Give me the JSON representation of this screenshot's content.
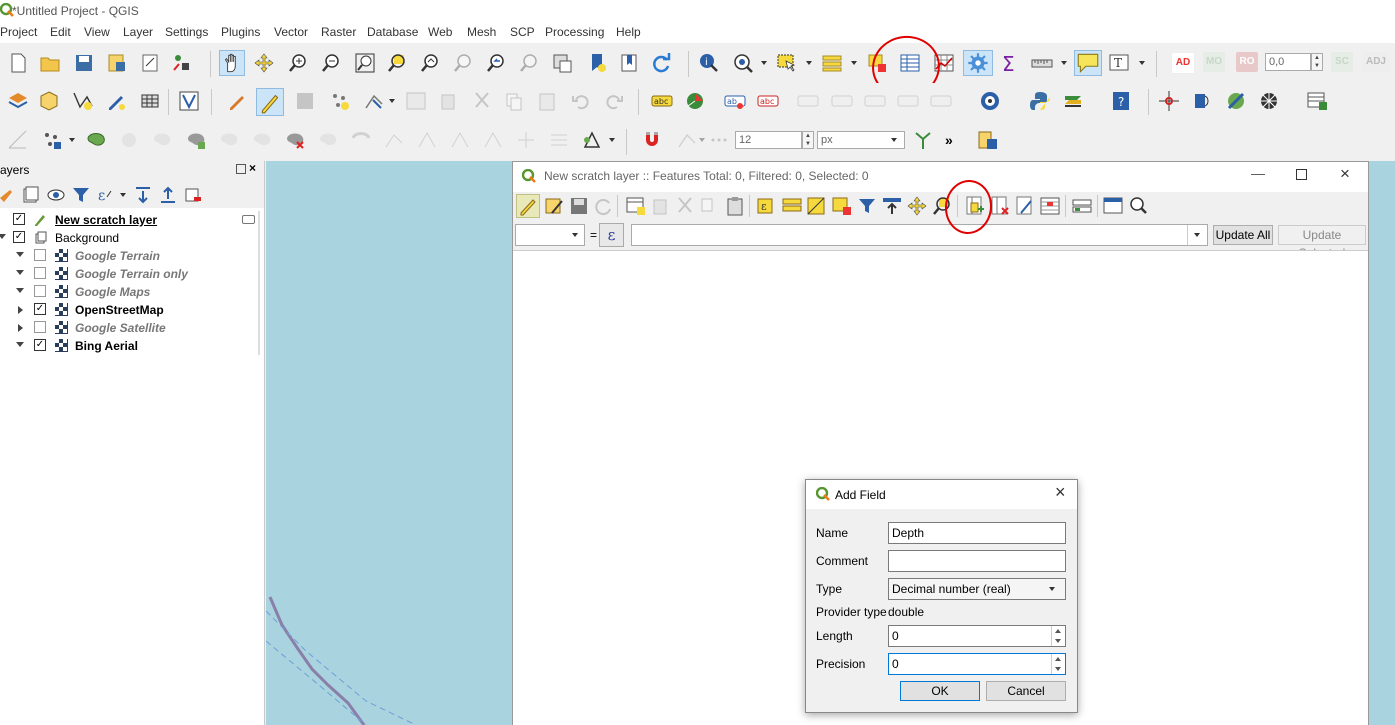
{
  "app": {
    "window_title": "*Untitled Project - QGIS"
  },
  "menubar": {
    "items": [
      "Project",
      "Edit",
      "View",
      "Layer",
      "Settings",
      "Plugins",
      "Vector",
      "Raster",
      "Database",
      "Web",
      "Mesh",
      "SCP",
      "Processing",
      "Help"
    ]
  },
  "toolbar": {
    "rotation_value": "0,0",
    "font_size_value": "12",
    "unit_value": "px",
    "badge_ad": "AD",
    "badge_mo": "MO",
    "badge_ro": "RO",
    "badge_sc": "SC",
    "badge_adj": "ADJ",
    "more_label": "»",
    "colors": {
      "accent_red": "#e00000",
      "selected_blue": "#cce4f7"
    }
  },
  "layers_panel": {
    "title": "ayers",
    "layers": [
      {
        "label": "New scratch layer",
        "checked": true,
        "style": "editing"
      },
      {
        "label": "Background",
        "checked": true,
        "style": "group"
      },
      {
        "label": "Google Terrain",
        "checked": false,
        "style": "disabled"
      },
      {
        "label": "Google Terrain only",
        "checked": false,
        "style": "disabled"
      },
      {
        "label": "Google Maps",
        "checked": false,
        "style": "disabled"
      },
      {
        "label": "OpenStreetMap",
        "checked": true,
        "style": "active"
      },
      {
        "label": "Google Satellite",
        "checked": false,
        "style": "disabled"
      },
      {
        "label": "Bing Aerial",
        "checked": true,
        "style": "active"
      }
    ]
  },
  "attribute_table": {
    "title": "New scratch layer :: Features Total: 0, Filtered: 0, Selected: 0",
    "equals": "=",
    "update_all": "Update All",
    "update_selected": "Update Selected"
  },
  "add_field_dialog": {
    "title": "Add Field",
    "name_label": "Name",
    "name_value": "Depth",
    "comment_label": "Comment",
    "comment_value": "",
    "type_label": "Type",
    "type_value": "Decimal number (real)",
    "provider_type_label": "Provider type",
    "provider_type_value": "double",
    "length_label": "Length",
    "length_value": "0",
    "precision_label": "Precision",
    "precision_value": "0",
    "ok_label": "OK",
    "cancel_label": "Cancel"
  }
}
